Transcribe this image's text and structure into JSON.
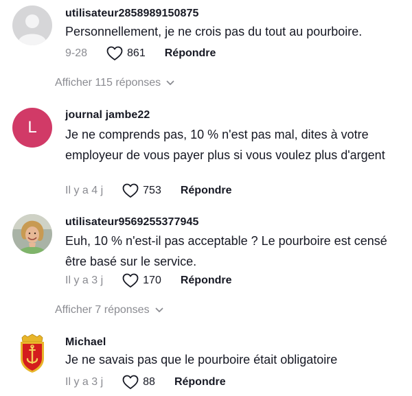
{
  "comments": [
    {
      "username": "utilisateur2858989150875",
      "text": "Personnellement, je ne crois pas du tout au pourboire.",
      "time": "9-28",
      "likes": "861",
      "reply_label": "Répondre",
      "avatar": "default-user-avatar"
    },
    {
      "username": "journal jambe22",
      "text": "Je ne comprends pas, 10 % n'est pas mal, dites à votre employeur de vous payer plus si vous voulez plus d'argent",
      "time": "Il y a 4 j",
      "likes": "753",
      "reply_label": "Répondre",
      "avatar": "letter-avatar",
      "avatar_letter": "L",
      "avatar_color": "#d13a67"
    },
    {
      "username": "utilisateur9569255377945",
      "text": "Euh, 10 % n'est-il pas acceptable ? Le pourboire est censé être basé sur le service.",
      "time": "Il y a 3 j",
      "likes": "170",
      "reply_label": "Répondre",
      "avatar": "photo-avatar"
    },
    {
      "username": "Michael",
      "text": "Je ne savais pas que le pourboire était obligatoire",
      "time": "Il y a 3 j",
      "likes": "88",
      "reply_label": "Répondre",
      "avatar": "coat-of-arms-avatar"
    }
  ],
  "replies_toggles": [
    {
      "label": "Afficher 115 réponses"
    },
    {
      "label": "Afficher 7 réponses"
    }
  ],
  "colors": {
    "text": "#161823",
    "muted": "#8a8b91",
    "letter_avatar": "#d13a67"
  }
}
